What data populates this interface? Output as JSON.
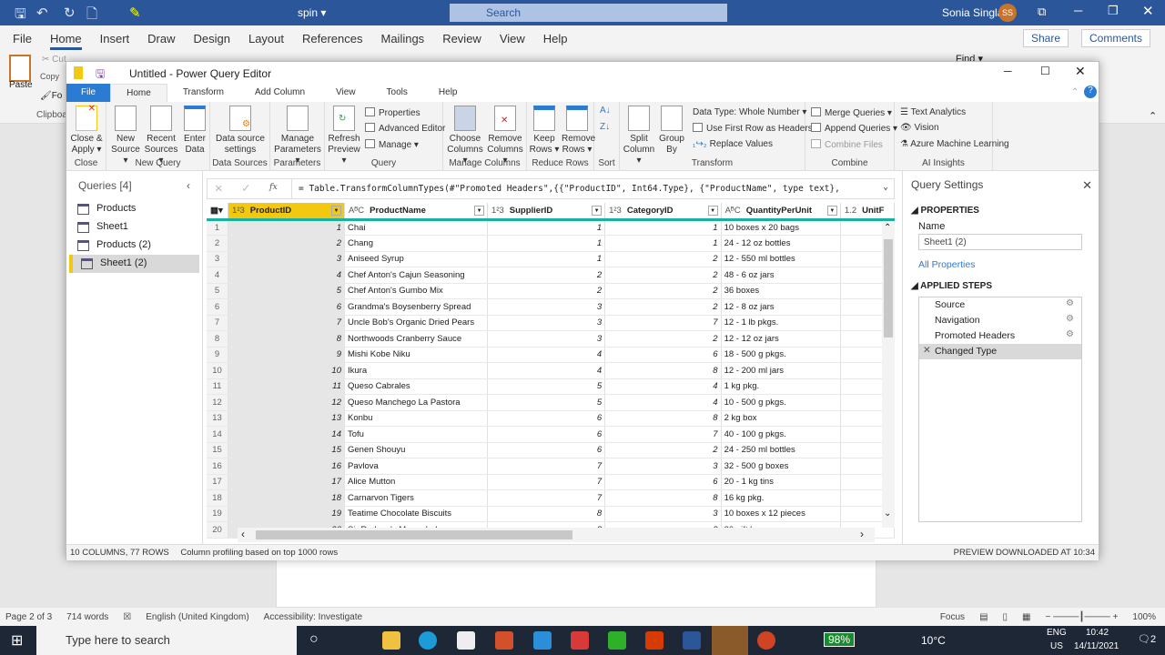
{
  "word": {
    "doc_title": "spin ▾",
    "search_placeholder": "Search",
    "user": "Sonia Singla",
    "avatar": "SS",
    "tabs": [
      "File",
      "Home",
      "Insert",
      "Draw",
      "Design",
      "Layout",
      "References",
      "Mailings",
      "Review",
      "View",
      "Help"
    ],
    "active_tab": "Home",
    "share": "Share",
    "comments": "Comments",
    "clipboard": {
      "paste": "Paste",
      "cut": "Cut",
      "copy": "Copy",
      "format": "Fo",
      "group": "Clipboa"
    },
    "find": "Find ▾",
    "status": {
      "page": "Page 2 of 3",
      "words": "714 words",
      "language": "English (United Kingdom)",
      "accessibility": "Accessibility: Investigate",
      "focus": "Focus",
      "zoom": "100%"
    }
  },
  "taskbar": {
    "search_placeholder": "Type here to search",
    "battery": "98%",
    "weather": "10°C",
    "lang1": "ENG",
    "lang2": "US",
    "time": "10:42",
    "date": "14/11/2021",
    "notifications": "2"
  },
  "pq": {
    "title": "Untitled - Power Query Editor",
    "tabs": [
      "File",
      "Home",
      "Transform",
      "Add Column",
      "View",
      "Tools",
      "Help"
    ],
    "active_tab": "Home",
    "ribbon": {
      "close_apply": "Close & Apply ▾",
      "close_group": "Close",
      "new_source": "New Source ▾",
      "recent_sources": "Recent Sources ▾",
      "enter_data": "Enter Data",
      "new_query_group": "New Query",
      "data_source_settings": "Data source settings",
      "data_sources_group": "Data Sources",
      "manage_parameters": "Manage Parameters ▾",
      "parameters_group": "Parameters",
      "refresh_preview": "Refresh Preview ▾",
      "properties": "Properties",
      "advanced_editor": "Advanced Editor",
      "manage": "Manage ▾",
      "query_group": "Query",
      "choose_columns": "Choose Columns ▾",
      "remove_columns": "Remove Columns ▾",
      "manage_columns_group": "Manage Columns",
      "keep_rows": "Keep Rows ▾",
      "remove_rows": "Remove Rows ▾",
      "reduce_rows_group": "Reduce Rows",
      "sort_group": "Sort",
      "split_column": "Split Column ▾",
      "group_by": "Group By",
      "data_type": "Data Type: Whole Number ▾",
      "first_row_headers": "Use First Row as Headers ▾",
      "replace_values": "Replace Values",
      "transform_group": "Transform",
      "merge_queries": "Merge Queries ▾",
      "append_queries": "Append Queries ▾",
      "combine_files": "Combine Files",
      "combine_group": "Combine",
      "text_analytics": "Text Analytics",
      "vision": "Vision",
      "azure_ml": "Azure Machine Learning",
      "ai_group": "AI Insights"
    },
    "queries": {
      "header": "Queries [4]",
      "items": [
        "Products",
        "Sheet1",
        "Products (2)",
        "Sheet1 (2)"
      ],
      "selected": "Sheet1 (2)"
    },
    "formula": {
      "fx": "fx",
      "text": "= Table.TransformColumnTypes(#\"Promoted Headers\",{{\"ProductID\", Int64.Type}, {\"ProductName\", type text},"
    },
    "columns": [
      {
        "type": "1²3",
        "name": "ProductID"
      },
      {
        "type": "AᴮC",
        "name": "ProductName"
      },
      {
        "type": "1²3",
        "name": "SupplierID"
      },
      {
        "type": "1²3",
        "name": "CategoryID"
      },
      {
        "type": "AᴮC",
        "name": "QuantityPerUnit"
      },
      {
        "type": "1.2",
        "name": "UnitF"
      }
    ],
    "rows": [
      [
        1,
        "Chai",
        1,
        1,
        "10 boxes x 20 bags"
      ],
      [
        2,
        "Chang",
        1,
        1,
        "24 - 12 oz bottles"
      ],
      [
        3,
        "Aniseed Syrup",
        1,
        2,
        "12 - 550 ml bottles"
      ],
      [
        4,
        "Chef Anton's Cajun Seasoning",
        2,
        2,
        "48 - 6 oz jars"
      ],
      [
        5,
        "Chef Anton's Gumbo Mix",
        2,
        2,
        "36 boxes"
      ],
      [
        6,
        "Grandma's Boysenberry Spread",
        3,
        2,
        "12 - 8 oz jars"
      ],
      [
        7,
        "Uncle Bob's Organic Dried Pears",
        3,
        7,
        "12 - 1 lb pkgs."
      ],
      [
        8,
        "Northwoods Cranberry Sauce",
        3,
        2,
        "12 - 12 oz jars"
      ],
      [
        9,
        "Mishi Kobe Niku",
        4,
        6,
        "18 - 500 g pkgs."
      ],
      [
        10,
        "Ikura",
        4,
        8,
        "12 - 200 ml jars"
      ],
      [
        11,
        "Queso Cabrales",
        5,
        4,
        "1 kg pkg."
      ],
      [
        12,
        "Queso Manchego La Pastora",
        5,
        4,
        "10 - 500 g pkgs."
      ],
      [
        13,
        "Konbu",
        6,
        8,
        "2 kg box"
      ],
      [
        14,
        "Tofu",
        6,
        7,
        "40 - 100 g pkgs."
      ],
      [
        15,
        "Genen Shouyu",
        6,
        2,
        "24 - 250 ml bottles"
      ],
      [
        16,
        "Pavlova",
        7,
        3,
        "32 - 500 g boxes"
      ],
      [
        17,
        "Alice Mutton",
        7,
        6,
        "20 - 1 kg tins"
      ],
      [
        18,
        "Carnarvon Tigers",
        7,
        8,
        "16 kg pkg."
      ],
      [
        19,
        "Teatime Chocolate Biscuits",
        8,
        3,
        "10 boxes x 12 pieces"
      ],
      [
        20,
        "Sir Rodney's Marmalade",
        8,
        3,
        "30 gift boxes"
      ]
    ],
    "settings": {
      "title": "Query Settings",
      "properties": "PROPERTIES",
      "name_label": "Name",
      "name_value": "Sheet1 (2)",
      "all_properties": "All Properties",
      "applied_steps": "APPLIED STEPS",
      "steps": [
        "Source",
        "Navigation",
        "Promoted Headers",
        "Changed Type"
      ],
      "selected_step": "Changed Type"
    },
    "status": {
      "left": "10 COLUMNS, 77 ROWS",
      "profiling": "Column profiling based on top 1000 rows",
      "right": "PREVIEW DOWNLOADED AT 10:34"
    }
  },
  "colors": {
    "word_blue": "#2b579a",
    "pq_accent": "#f2c811",
    "column_quality": "#19b0a0",
    "file_tab": "#2b7bd3"
  }
}
